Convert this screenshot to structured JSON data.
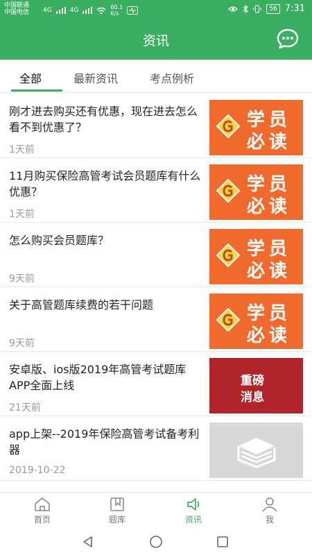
{
  "status_bar": {
    "carrier_1": "中国联通",
    "carrier_2": "中国电信",
    "net_1": "4G",
    "net_2": "4G",
    "speed_value": "60.1",
    "speed_unit": "K/s",
    "battery": "56",
    "time": "7:31"
  },
  "app_bar": {
    "title": "资讯",
    "chat_icon": "chat-bubble-icon"
  },
  "tabs": [
    {
      "label": "全部",
      "active": true
    },
    {
      "label": "最新资讯",
      "active": false
    },
    {
      "label": "考点例析",
      "active": false
    }
  ],
  "news": [
    {
      "title": "刚才进去购买还有优惠，现在进去怎么看不到优惠了？",
      "date": "1天前",
      "thumb": {
        "line1": "学员",
        "line2": "必读"
      }
    },
    {
      "title": "11月购买保险高管考试会员题库有什么优惠？",
      "date": "1天前",
      "thumb": {
        "line1": "学员",
        "line2": "必读"
      }
    },
    {
      "title": "怎么购买会员题库？",
      "date": "9天前",
      "thumb": {
        "line1": "学员",
        "line2": "必读"
      }
    },
    {
      "title": "关于高管题库续费的若干问题",
      "date": "9天前",
      "thumb": {
        "line1": "学员",
        "line2": "必读"
      }
    },
    {
      "title": "安卓版、ios版2019年高管考试题库APP全面上线",
      "date": "21天前",
      "thumb": {
        "line1": "重磅",
        "line2": "消息"
      }
    },
    {
      "title": "app上架--2019年保险高管考试备考利器",
      "date": "2019-10-22",
      "thumb": {
        "icon": "book-stack-icon"
      }
    }
  ],
  "bottom_nav": [
    {
      "label": "首页",
      "icon": "home-icon",
      "active": false
    },
    {
      "label": "题库",
      "icon": "bookmark-book-icon",
      "active": false
    },
    {
      "label": "资讯",
      "icon": "speaker-icon",
      "active": true
    },
    {
      "label": "我",
      "icon": "user-icon",
      "active": false
    }
  ],
  "colors": {
    "brand_green": "#3aae61",
    "badge_orange": "#ef6a2c",
    "badge_red": "#b02529"
  }
}
